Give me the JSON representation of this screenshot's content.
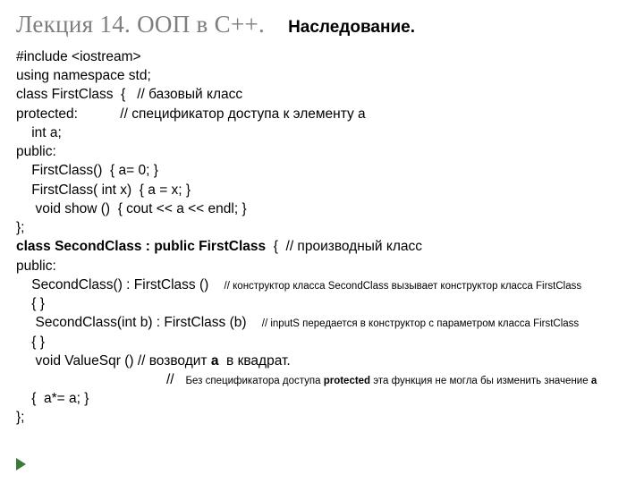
{
  "title": "Лекция 14. ООП в С++.",
  "subtitle": "Наследование.",
  "lines": {
    "l01": "#include <iostream>",
    "l02": "using namespace std;",
    "l03": "class FirstClass  {   // базовый класс",
    "l04": "protected:           // спецификатор доступа к элементу a",
    "l05": "    int a;",
    "l06": "public:",
    "l07": "    FirstClass()  { a= 0; }",
    "l08": "    FirstClass( int x)  { a = x; }",
    "l09": "     void show ()  { cout << a << endl; }",
    "l10": "};",
    "l11a": "class SecondClass : public FirstClass",
    "l11b": "  {  // производный класс",
    "l12": "public:",
    "l13a": "    SecondClass() : FirstClass ()    ",
    "l13b": "// конструктор класса SecondClass вызывает конструктор класса FirstClass",
    "l14": "    { }",
    "l15a": "     SecondClass(int b) : FirstClass (b)    ",
    "l15b": "// inputS передается в конструктор с параметром класса FirstClass",
    "l16": "    { }",
    "l17a": "     void ValueSqr () // возводит ",
    "l17b": "а",
    "l17c": "  в квадрат.",
    "l18a": "                                       //   ",
    "l18b": "Без спецификатора доступа ",
    "l18c": "protected",
    "l18d": " эта функция не могла бы изменить значение ",
    "l18e": "а",
    "l19": "    {  a*= a; }",
    "l20": "};"
  }
}
